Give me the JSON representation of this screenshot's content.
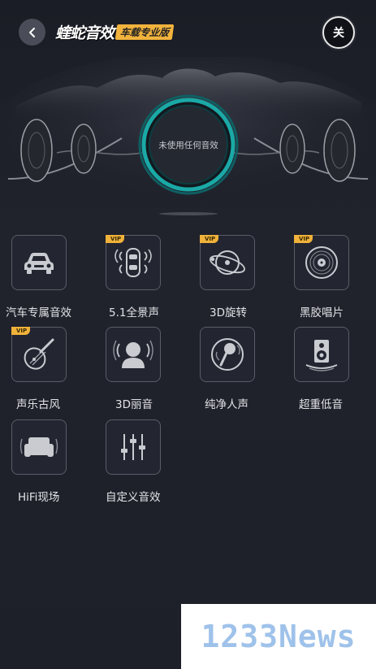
{
  "header": {
    "brand_name": "蝰蛇音效",
    "brand_badge": "车载专业版",
    "power_label": "关",
    "back_icon": "chevron-left-icon"
  },
  "visualizer": {
    "status_text": "未使用任何音效",
    "accent": "#1aa9a6"
  },
  "effects": [
    {
      "label": "汽车专属音效",
      "icon": "car-icon",
      "vip": false
    },
    {
      "label": "5.1全景声",
      "icon": "surround-car-icon",
      "vip": true
    },
    {
      "label": "3D旋转",
      "icon": "orbit-icon",
      "vip": true
    },
    {
      "label": "黑胶唱片",
      "icon": "vinyl-icon",
      "vip": true
    },
    {
      "label": "声乐古风",
      "icon": "pipa-icon",
      "vip": true
    },
    {
      "label": "3D丽音",
      "icon": "head-icon",
      "vip": false
    },
    {
      "label": "纯净人声",
      "icon": "microphone-icon",
      "vip": false
    },
    {
      "label": "超重低音",
      "icon": "speaker-icon",
      "vip": false
    },
    {
      "label": "HiFi现场",
      "icon": "sofa-icon",
      "vip": false
    },
    {
      "label": "自定义音效",
      "icon": "equalizer-icon",
      "vip": false
    }
  ],
  "vip_badge": "VIP",
  "watermark": "1233News",
  "colors": {
    "background": "#1d1f29",
    "vip": "#f0b23a",
    "brand_badge": "#f2b33d",
    "tile_border": "#5a5d67"
  }
}
